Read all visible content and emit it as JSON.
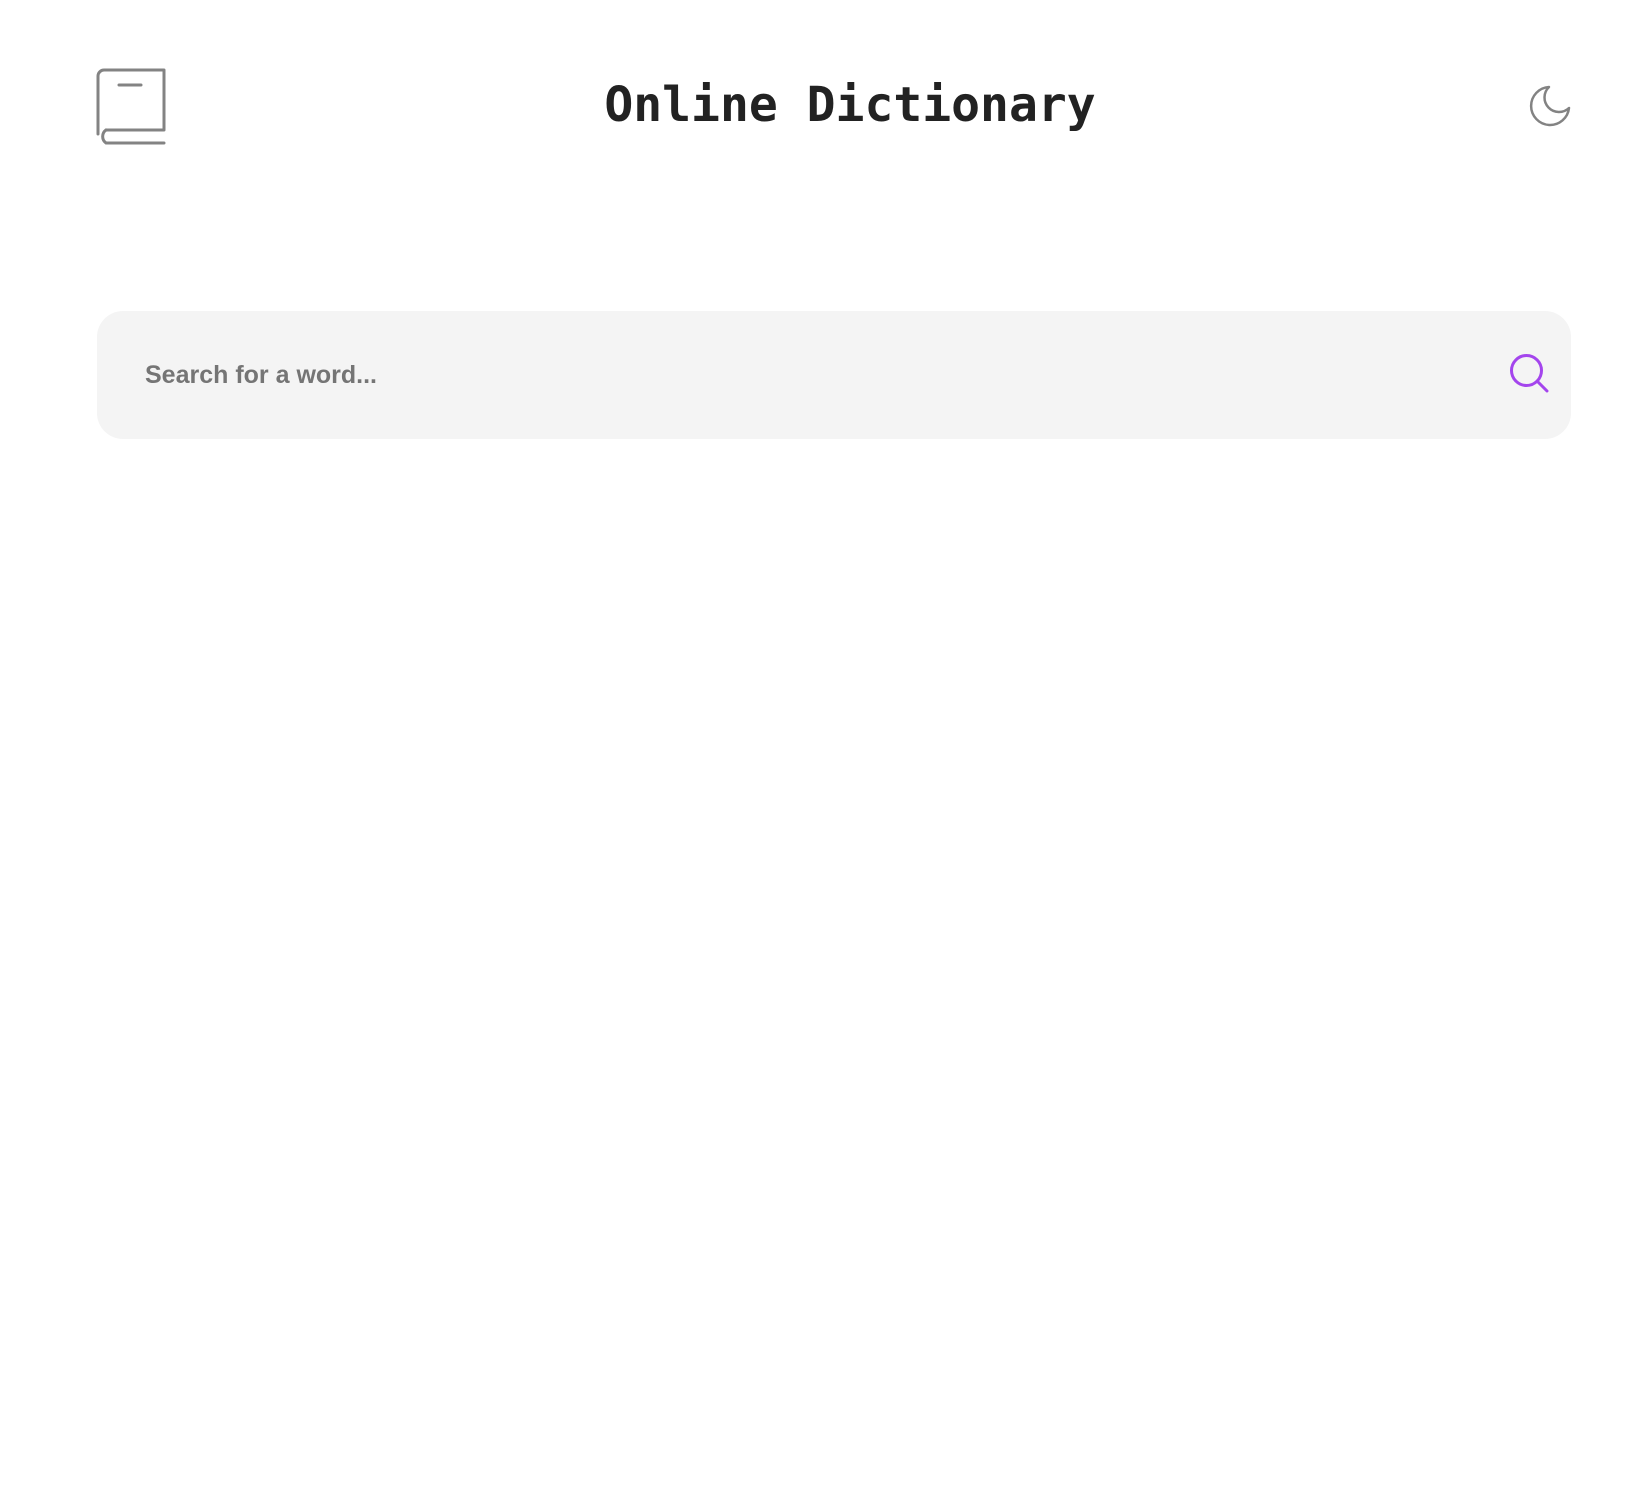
{
  "header": {
    "title": "Online Dictionary",
    "logo_icon": "book-icon",
    "theme_toggle_icon": "moon-icon"
  },
  "search": {
    "placeholder": "Search for a word...",
    "value": "",
    "button_icon": "search-icon"
  },
  "colors": {
    "accent": "#a445ed",
    "title_text": "#222222",
    "icon_gray": "#838383",
    "search_background": "#f4f4f4",
    "placeholder_text": "#757575",
    "page_background": "#ffffff"
  }
}
